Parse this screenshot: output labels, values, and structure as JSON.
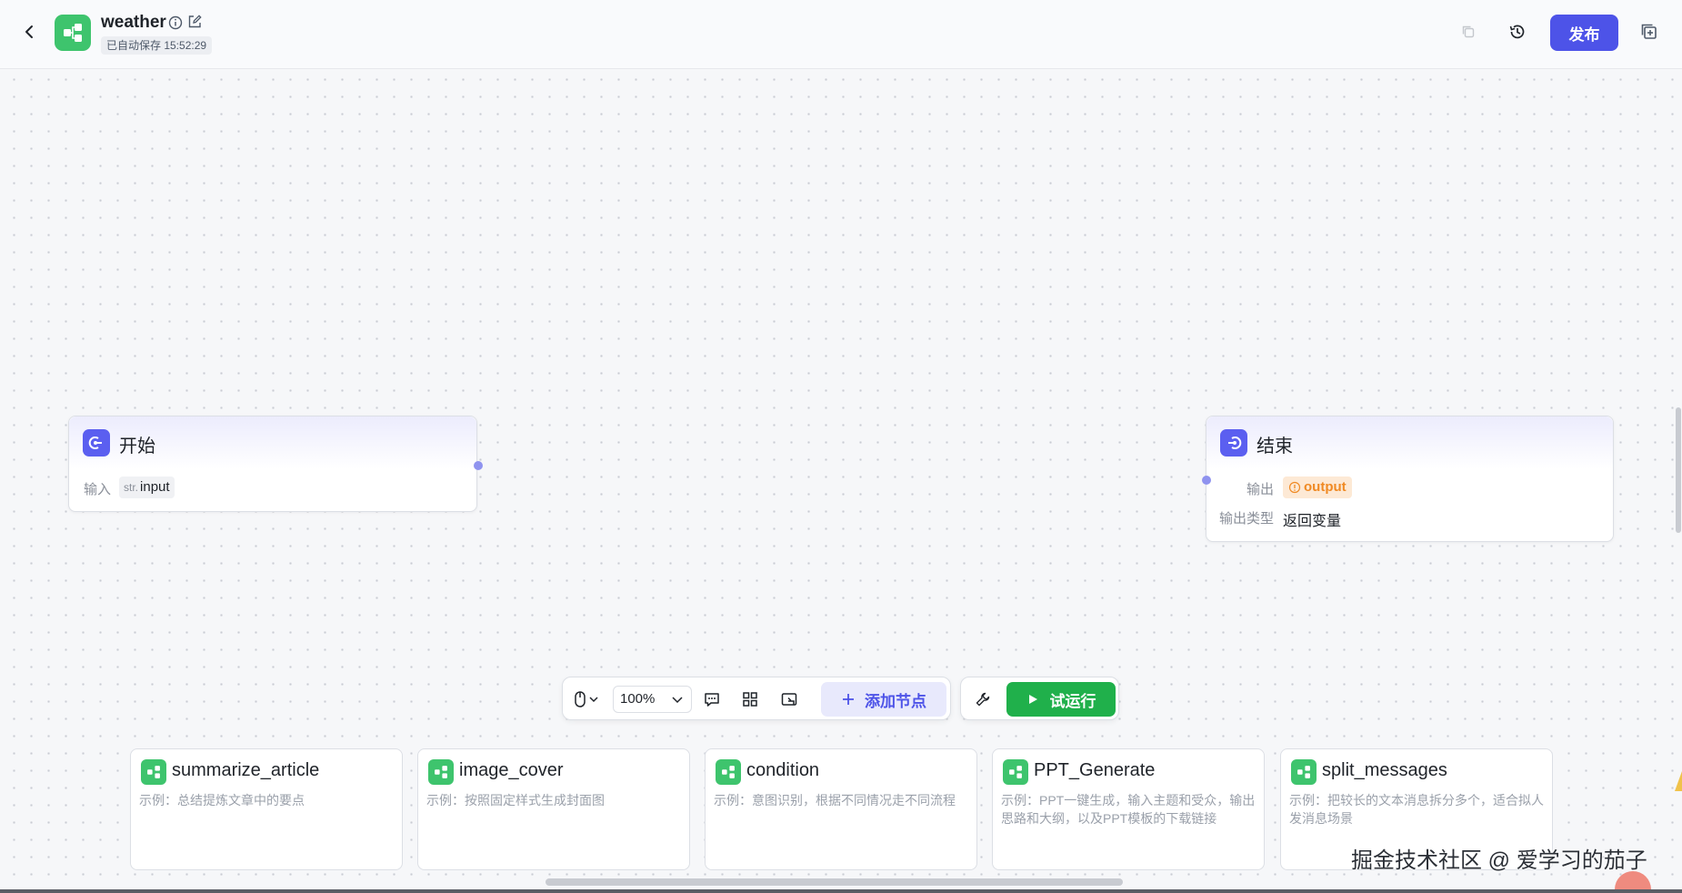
{
  "header": {
    "title": "weather",
    "autosave": "已自动保存 15:52:29",
    "publish_label": "发布"
  },
  "nodes": {
    "start": {
      "title": "开始",
      "input_label": "输入",
      "input_type": "str.",
      "input_name": "input"
    },
    "end": {
      "title": "结束",
      "output_label": "输出",
      "output_var": "output",
      "output_type_label": "输出类型",
      "output_type_value": "返回变量"
    }
  },
  "toolbar": {
    "zoom": "100%",
    "add_node_label": "添加节点",
    "run_label": "试运行"
  },
  "templates": [
    {
      "title": "summarize_article",
      "desc": "示例：总结提炼文章中的要点"
    },
    {
      "title": "image_cover",
      "desc": "示例：按照固定样式生成封面图"
    },
    {
      "title": "condition",
      "desc": "示例：意图识别，根据不同情况走不同流程"
    },
    {
      "title": "PPT_Generate",
      "desc": "示例：PPT一键生成，输入主题和受众，输出思路和大纲，以及PPT模板的下载链接"
    },
    {
      "title": "split_messages",
      "desc": "示例：把较长的文本消息拆分多个，适合拟人发消息场景"
    }
  ],
  "watermark": "掘金技术社区 @ 爱学习的茄子",
  "colors": {
    "brand": "#4d53e8",
    "run": "#20b04b",
    "app_icon": "#3ec46d",
    "output_tag": "#f08a24"
  },
  "icons": {
    "back": "chevron-left-icon",
    "info": "info-icon",
    "edit": "edit-icon",
    "copy": "copy-icon",
    "history": "history-icon",
    "sidebar": "panel-icon",
    "mouse": "mouse-icon",
    "comment": "comment-icon",
    "layout": "grid-icon",
    "minimap": "minimap-icon",
    "wrench": "wrench-icon",
    "play": "play-icon"
  }
}
